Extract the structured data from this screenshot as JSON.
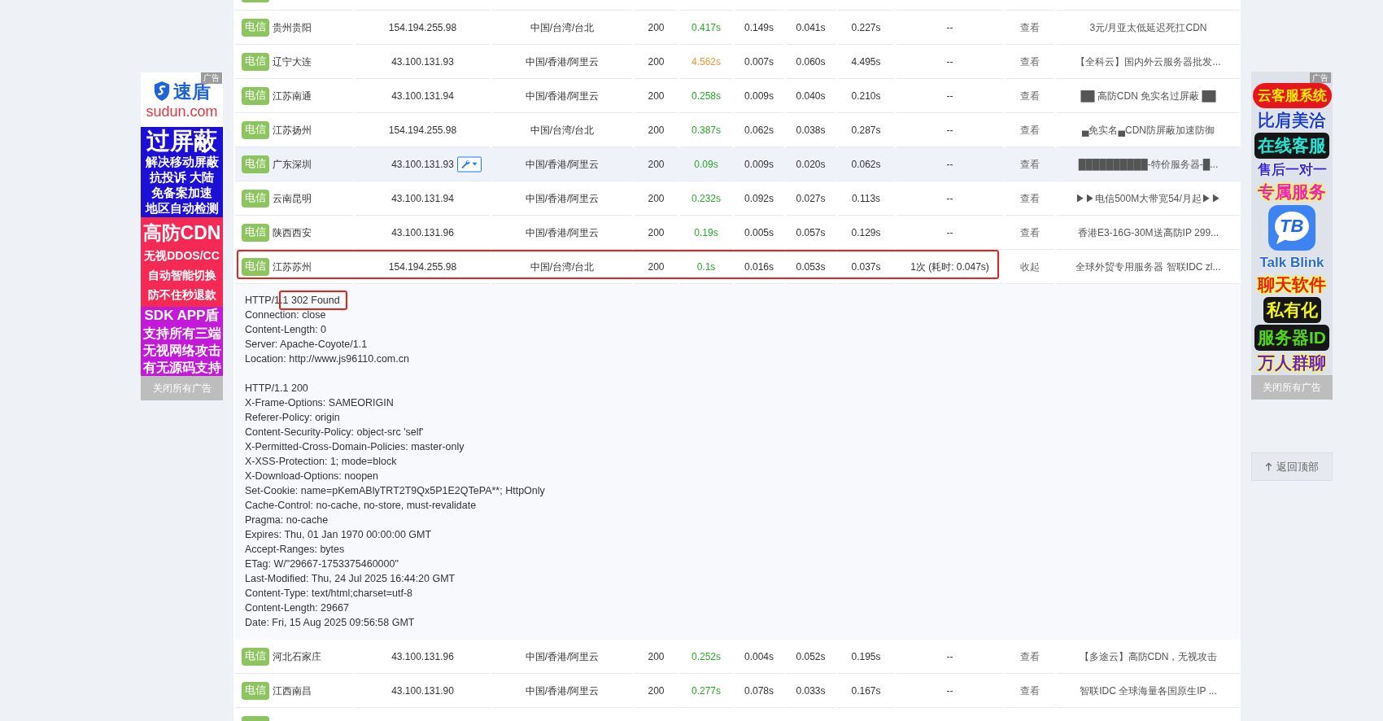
{
  "left_ad": {
    "label": "广告",
    "brand": "速盾",
    "domain": "sudun.com",
    "panels": [
      {
        "color": "#1c10d6",
        "headline": "过屏蔽",
        "lines": [
          "解决移动屏蔽",
          "抗投诉 大陆",
          "免备案加速",
          "地区自动检测"
        ]
      },
      {
        "color": "#f42a55",
        "headline": "高防CDN",
        "lines": [
          "无视DDOS/CC",
          "自动智能切换",
          "防不住秒退款"
        ]
      },
      {
        "color": "#c21ad8",
        "headline": "SDK APP盾",
        "lines": [
          "支持所有三端",
          "无视网络攻击",
          "有无源码支持"
        ]
      }
    ],
    "close": "关闭所有广告"
  },
  "table": {
    "rows": [
      {
        "isp": "电信",
        "city": "贵州贵阳",
        "ip": "154.194.255.98",
        "tools_button": false,
        "ip_location": "中国/台湾/台北",
        "status": "200",
        "total_time": {
          "text": "0.417s",
          "color": "#28a828"
        },
        "time_2": "0.149s",
        "time_3": "0.041s",
        "time_4": "0.227s",
        "column_9": "--",
        "action": "查看",
        "ad": "3元/月亚太低延迟死扛CDN",
        "hovered": false,
        "outlined": false,
        "expanded": false
      },
      {
        "isp": "电信",
        "city": "辽宁大连",
        "ip": "43.100.131.93",
        "tools_button": false,
        "ip_location": "中国/香港/阿里云",
        "status": "200",
        "total_time": {
          "text": "4.562s",
          "color": "#f39530"
        },
        "time_2": "0.007s",
        "time_3": "0.060s",
        "time_4": "4.495s",
        "column_9": "--",
        "action": "查看",
        "ad": "【全科云】国内外云服务器批发...",
        "hovered": false,
        "outlined": false,
        "expanded": false
      },
      {
        "isp": "电信",
        "city": "江苏南通",
        "ip": "43.100.131.94",
        "tools_button": false,
        "ip_location": "中国/香港/阿里云",
        "status": "200",
        "total_time": {
          "text": "0.258s",
          "color": "#28a828"
        },
        "time_2": "0.009s",
        "time_3": "0.040s",
        "time_4": "0.210s",
        "column_9": "--",
        "action": "查看",
        "ad": "██ 高防CDN 免实名过屏蔽 ██",
        "hovered": false,
        "outlined": false,
        "expanded": false
      },
      {
        "isp": "电信",
        "city": "江苏扬州",
        "ip": "154.194.255.98",
        "tools_button": false,
        "ip_location": "中国/台湾/台北",
        "status": "200",
        "total_time": {
          "text": "0.387s",
          "color": "#28a828"
        },
        "time_2": "0.062s",
        "time_3": "0.038s",
        "time_4": "0.287s",
        "column_9": "--",
        "action": "查看",
        "ad": "▄免实名▄CDN防屏蔽加速防御",
        "hovered": false,
        "outlined": false,
        "expanded": false
      },
      {
        "isp": "电信",
        "city": "广东深圳",
        "ip": "43.100.131.93",
        "tools_button": true,
        "ip_location": "中国/香港/阿里云",
        "status": "200",
        "total_time": {
          "text": "0.09s",
          "color": "#28a828"
        },
        "time_2": "0.009s",
        "time_3": "0.020s",
        "time_4": "0.062s",
        "column_9": "--",
        "action": "查看",
        "ad": "██████████-特价服务器-█...",
        "hovered": true,
        "outlined": false,
        "expanded": false
      },
      {
        "isp": "电信",
        "city": "云南昆明",
        "ip": "43.100.131.94",
        "tools_button": false,
        "ip_location": "中国/香港/阿里云",
        "status": "200",
        "total_time": {
          "text": "0.232s",
          "color": "#28a828"
        },
        "time_2": "0.092s",
        "time_3": "0.027s",
        "time_4": "0.113s",
        "column_9": "--",
        "action": "查看",
        "ad": "▶▶电信500M大带宽54/月起▶▶",
        "hovered": false,
        "outlined": false,
        "expanded": false
      },
      {
        "isp": "电信",
        "city": "陕西西安",
        "ip": "43.100.131.96",
        "tools_button": false,
        "ip_location": "中国/香港/阿里云",
        "status": "200",
        "total_time": {
          "text": "0.19s",
          "color": "#28a828"
        },
        "time_2": "0.005s",
        "time_3": "0.057s",
        "time_4": "0.129s",
        "column_9": "--",
        "action": "查看",
        "ad": "香港E3-16G-30M送高防IP 299...",
        "hovered": false,
        "outlined": false,
        "expanded": false
      },
      {
        "isp": "电信",
        "city": "江苏苏州",
        "ip": "154.194.255.98",
        "tools_button": false,
        "ip_location": "中国/台湾/台北",
        "status": "200",
        "total_time": {
          "text": "0.1s",
          "color": "#28a828"
        },
        "time_2": "0.016s",
        "time_3": "0.053s",
        "time_4": "0.037s",
        "column_9": "1次 (耗时: 0.047s)",
        "action": "收起",
        "ad": "全球外贸专用服务器 智联IDC zl...",
        "hovered": false,
        "outlined": true,
        "expanded": true,
        "details": {
          "responses": [
            {
              "status_line": "HTTP/1.1 302 Found",
              "status_marked": true,
              "headers": [
                "Connection: close",
                "Content-Length: 0",
                "Server: Apache-Coyote/1.1",
                "Location: http://www.js96110.com.cn"
              ]
            },
            {
              "status_line": "HTTP/1.1 200",
              "status_marked": false,
              "headers": [
                "X-Frame-Options: SAMEORIGIN",
                "Referer-Policy: origin",
                "Content-Security-Policy: object-src 'self'",
                "X-Permitted-Cross-Domain-Policies: master-only",
                "X-XSS-Protection: 1; mode=block",
                "X-Download-Options: noopen",
                "Set-Cookie: name=pKemABlyTRT2T9Qx5P1E2QTePA**; HttpOnly",
                "Cache-Control: no-cache, no-store, must-revalidate",
                "Pragma: no-cache",
                "Expires: Thu, 01 Jan 1970 00:00:00 GMT",
                "Accept-Ranges: bytes",
                "ETag: W/\"29667-1753375460000\"",
                "Last-Modified: Thu, 24 Jul 2025 16:44:20 GMT",
                "Content-Type: text/html;charset=utf-8",
                "Content-Length: 29667",
                "Date: Fri, 15 Aug 2025 09:56:58 GMT"
              ]
            }
          ]
        }
      },
      {
        "isp": "电信",
        "city": "河北石家庄",
        "ip": "43.100.131.96",
        "tools_button": false,
        "ip_location": "中国/香港/阿里云",
        "status": "200",
        "total_time": {
          "text": "0.252s",
          "color": "#28a828"
        },
        "time_2": "0.004s",
        "time_3": "0.052s",
        "time_4": "0.195s",
        "column_9": "--",
        "action": "查看",
        "ad": "【多途云】高防CDN，无视攻击",
        "hovered": false,
        "outlined": false,
        "expanded": false
      },
      {
        "isp": "电信",
        "city": "江西南昌",
        "ip": "43.100.131.90",
        "tools_button": false,
        "ip_location": "中国/香港/阿里云",
        "status": "200",
        "total_time": {
          "text": "0.277s",
          "color": "#28a828"
        },
        "time_2": "0.078s",
        "time_3": "0.033s",
        "time_4": "0.167s",
        "column_9": "--",
        "action": "查看",
        "ad": "智联IDC 全球海量各国原生IP ...",
        "hovered": false,
        "outlined": false,
        "expanded": false
      }
    ]
  },
  "right_ad": {
    "label": "广告",
    "items": [
      {
        "kind": "pill",
        "text": "云客服系统",
        "color": "#ffee00"
      },
      {
        "kind": "plain",
        "text": "比肩美洽",
        "color": "#1d3fd0"
      },
      {
        "kind": "dark_outline",
        "text": "在线客服",
        "color": "#27e6d6"
      },
      {
        "kind": "plain",
        "text": "售后一对一",
        "color": "#3a27d6"
      },
      {
        "kind": "light_outline",
        "text": "专属服务",
        "color": "#f21fc4"
      },
      {
        "kind": "logo",
        "text": "TB"
      },
      {
        "kind": "plain",
        "text": "Talk Blink",
        "color": "#2a6ad8"
      },
      {
        "kind": "light_outline",
        "text": "聊天软件",
        "color": "#ee1b1b"
      },
      {
        "kind": "dark_outline",
        "text": "私有化",
        "color": "#eef21e"
      },
      {
        "kind": "dark_outline",
        "text": "服务器ID",
        "color": "#52d81c"
      },
      {
        "kind": "light_outline",
        "text": "万人群聊",
        "color": "#6a1fe0"
      }
    ],
    "close": "关闭所有广告"
  },
  "back_to_top": "返回顶部"
}
